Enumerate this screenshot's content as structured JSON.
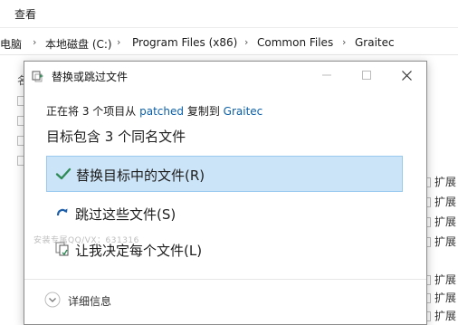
{
  "explorer": {
    "ribbon_tab": "查看",
    "breadcrumb": [
      "电脑",
      "本地磁盘 (C:)",
      "Program Files (x86)",
      "Common Files",
      "Graitec"
    ],
    "column_header": "名",
    "type_cells": [
      "扩展",
      "扩展",
      "扩展",
      "扩展",
      "扩展",
      "扩展",
      "扩展"
    ]
  },
  "dialog": {
    "title": "替换或跳过文件",
    "info_prefix": "正在将 3 个项目从",
    "source": "patched",
    "info_middle": "复制到",
    "destination": "Graitec",
    "headline": "目标包含 3 个同名文件",
    "options": [
      {
        "label": "替换目标中的文件(R)",
        "icon": "check-icon",
        "selected": true
      },
      {
        "label": "跳过这些文件(S)",
        "icon": "skip-arrow-icon",
        "selected": false
      },
      {
        "label": "让我决定每个文件(L)",
        "icon": "decide-files-icon",
        "selected": false
      }
    ],
    "details": "详细信息",
    "watermark": "安装专属QQ/VX：631316",
    "accent_color": "#0b5fa8",
    "selected_bg": "#cce4f7",
    "check_color": "#2e8b57"
  }
}
